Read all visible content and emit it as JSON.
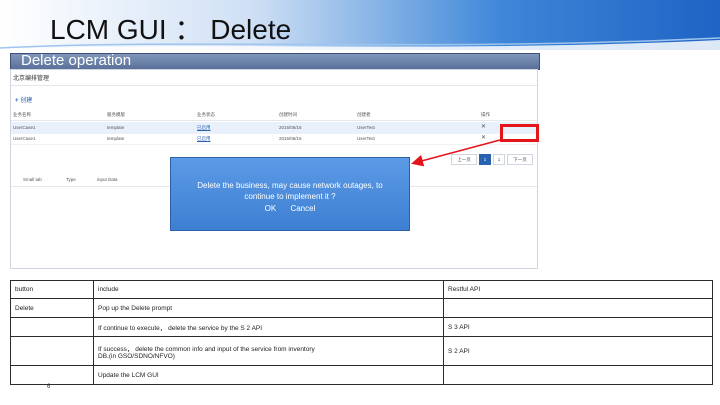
{
  "header": {
    "title": "LCM GUI ： Delete"
  },
  "section": {
    "label": "Delete operation"
  },
  "app": {
    "title": "北京编排管理",
    "create_label": "创建",
    "columns": [
      "业务名称",
      "服务模版",
      "业务状态",
      "创建时间",
      "创建者",
      "操作"
    ],
    "rows": [
      {
        "name": "UserCase1",
        "template": "template",
        "status": "已启用",
        "date": "2016/06/16",
        "owner": "UserTest",
        "action": "✕"
      },
      {
        "name": "UserCase1",
        "template": "template",
        "status": "已启用",
        "date": "2016/06/16",
        "owner": "UserTest",
        "action": "✕"
      }
    ],
    "pager": {
      "prev": "上一页",
      "current": "1",
      "next_num": "1",
      "next": "下一页"
    },
    "lower_columns": [
      "Small tab",
      "Type",
      "input Data"
    ]
  },
  "modal": {
    "message_line1": "Delete the business, may cause network outages, to",
    "message_line2": "continue to implement it ?",
    "ok_label": "OK",
    "cancel_label": "Cancel"
  },
  "info_table": {
    "headers": {
      "button": "button",
      "include": "include",
      "api": "Restful API"
    },
    "rows": [
      {
        "button": "Delete",
        "include": "Pop up the Delete prompt",
        "api": ""
      },
      {
        "button": "",
        "include": "If continue to execute， delete the service by the S 2 API",
        "api": "S 3 API"
      },
      {
        "button": "",
        "include_line1": "If success， delete the common info and input of the service from inventory",
        "include_line2": "DB.(in GSO/SDNO/NFVO)",
        "api": "S 2 API"
      },
      {
        "button": "",
        "include": "Update the LCM GUI",
        "api": ""
      }
    ]
  },
  "page_number": "6",
  "colors": {
    "accent": "#1f63c4",
    "modal": "#4a8ddc",
    "highlight": "#e3151a"
  }
}
